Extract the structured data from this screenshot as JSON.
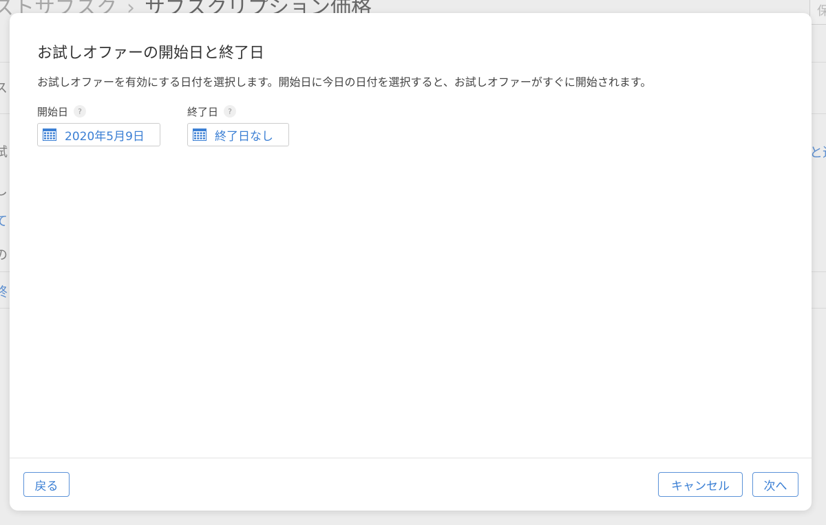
{
  "background": {
    "breadcrumb_parent": "ストサブスク",
    "breadcrumb_current": "サブスクリプション価格",
    "save_button_label": "保存",
    "fragments": [
      "ス",
      "試",
      "し",
      "て",
      "の",
      "終",
      "と追"
    ]
  },
  "modal": {
    "title": "お試しオファーの開始日と終了日",
    "description": "お試しオファーを有効にする日付を選択します。開始日に今日の日付を選択すると、お試しオファーがすぐに開始されます。",
    "start": {
      "label": "開始日",
      "help": "?",
      "value": "2020年5月9日"
    },
    "end": {
      "label": "終了日",
      "help": "?",
      "value": "終了日なし"
    }
  },
  "footer": {
    "back_label": "戻る",
    "cancel_label": "キャンセル",
    "next_label": "次へ"
  },
  "icons": {
    "calendar": "calendar-icon",
    "help": "help-icon"
  },
  "colors": {
    "accent": "#3b7fd4",
    "overlay": "#ececec"
  }
}
